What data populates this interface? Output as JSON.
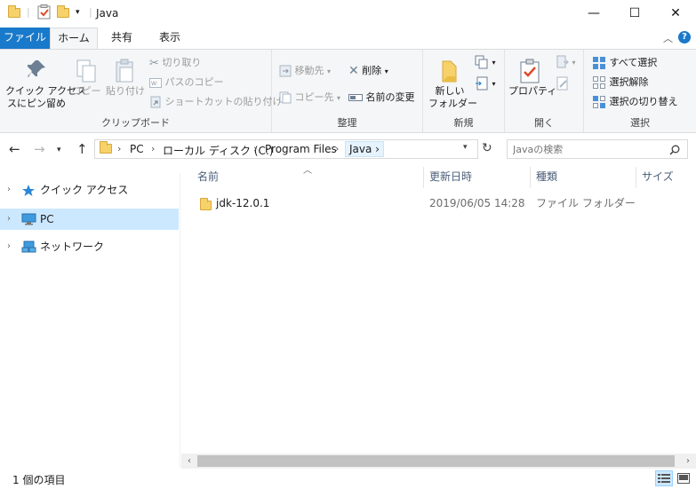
{
  "window": {
    "title": "Java",
    "minimize": "—",
    "maximize": "☐",
    "close": "✕"
  },
  "tabs": {
    "file": "ファイル",
    "home": "ホーム",
    "share": "共有",
    "view": "表示"
  },
  "ribbon": {
    "clipboard": {
      "label": "クリップボード",
      "pin": "クイック アクセス\nスにピン留め",
      "copy": "コピー",
      "paste": "貼り付け",
      "cut": "切り取り",
      "copy_path": "パスのコピー",
      "paste_shortcut": "ショートカットの貼り付け"
    },
    "organize": {
      "label": "整理",
      "move_to": "移動先",
      "copy_to": "コピー先",
      "delete": "削除",
      "rename": "名前の変更"
    },
    "new": {
      "label": "新規",
      "new_folder": "新しい\nフォルダー"
    },
    "open": {
      "label": "開く",
      "properties": "プロパティ"
    },
    "select": {
      "label": "選択",
      "select_all": "すべて選択",
      "select_none": "選択解除",
      "invert": "選択の切り替え"
    }
  },
  "address": {
    "crumbs": [
      "PC",
      "ローカル ディスク (C:)",
      "Program Files",
      "Java"
    ],
    "search_placeholder": "Javaの検索"
  },
  "sidebar": {
    "items": [
      {
        "label": "クイック アクセス",
        "icon": "star-icon",
        "selected": false
      },
      {
        "label": "PC",
        "icon": "computer-icon",
        "selected": true
      },
      {
        "label": "ネットワーク",
        "icon": "network-icon",
        "selected": false
      }
    ]
  },
  "list": {
    "headers": {
      "name": "名前",
      "date": "更新日時",
      "type": "種類",
      "size": "サイズ"
    },
    "rows": [
      {
        "name": "jdk-12.0.1",
        "date": "2019/06/05 14:28",
        "type": "ファイル フォルダー",
        "size": ""
      }
    ]
  },
  "status": {
    "count": "1 個の項目"
  },
  "colors": {
    "accent": "#1979ca",
    "selection": "#cce8ff",
    "folder": "#f7d26a"
  }
}
